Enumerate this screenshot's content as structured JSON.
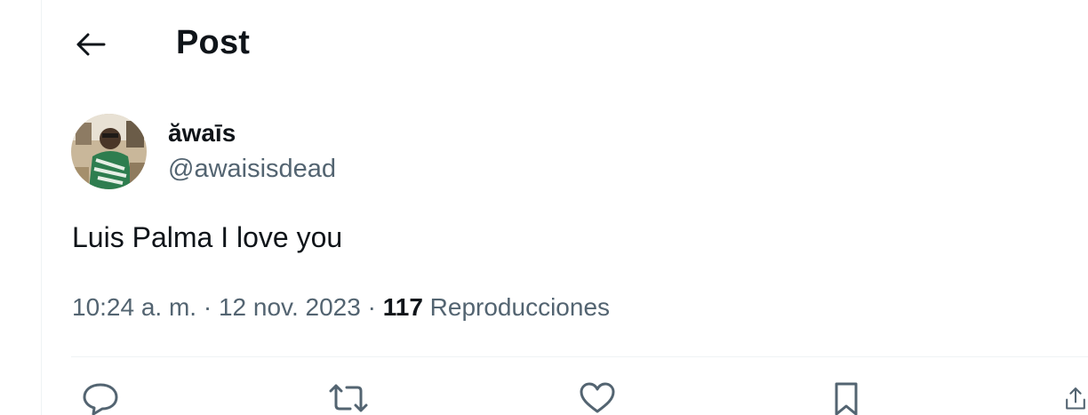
{
  "header": {
    "title": "Post",
    "back_icon": "arrow-left-icon"
  },
  "author": {
    "display_name": "ăwaīs",
    "handle": "@awaisisdead",
    "avatar": "avatar-photo"
  },
  "post": {
    "text": "Luis Palma I love you",
    "time": "10:24 a. m.",
    "separator": "·",
    "date": "12 nov. 2023",
    "views_count": "117",
    "views_label": "Reproducciones"
  },
  "actions": [
    {
      "name": "reply",
      "icon": "reply-icon"
    },
    {
      "name": "repost",
      "icon": "repost-icon"
    },
    {
      "name": "like",
      "icon": "heart-icon"
    },
    {
      "name": "bookmark",
      "icon": "bookmark-icon"
    },
    {
      "name": "share",
      "icon": "share-icon"
    }
  ],
  "colors": {
    "text_primary": "#0f1419",
    "text_secondary": "#536471",
    "divider": "#eff3f4"
  }
}
